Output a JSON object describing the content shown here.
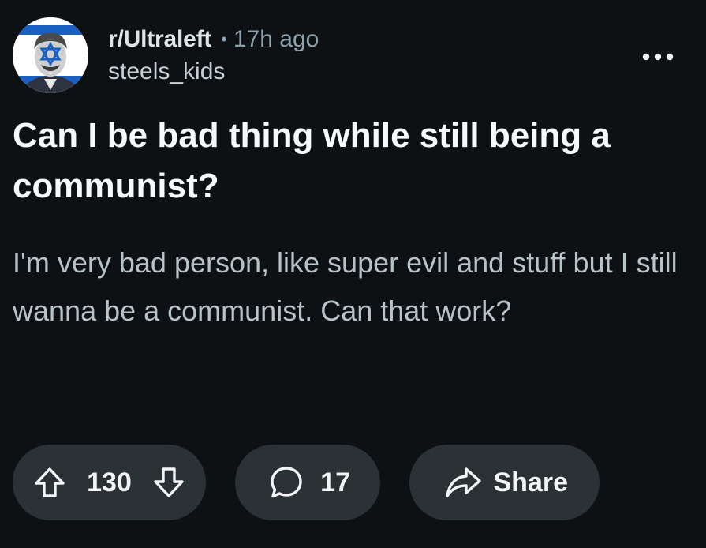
{
  "post": {
    "subreddit": "r/Ultraleft",
    "separator": "•",
    "time": "17h ago",
    "author": "steels_kids",
    "title": "Can I be bad thing while still being a communist?",
    "body": "I'm very bad person, like super evil and stuff but I still wanna be a communist. Can that work?"
  },
  "actions": {
    "upvotes": "130",
    "comments": "17",
    "share_label": "Share"
  },
  "icons": {
    "more": "more-options-icon",
    "upvote": "upvote-arrow-icon",
    "downvote": "downvote-arrow-icon",
    "comment": "comment-bubble-icon",
    "share": "share-arrow-icon"
  },
  "colors": {
    "background": "#0e1113",
    "pill": "#2a3236",
    "text_primary": "#f2f4f5",
    "text_secondary": "#8ba2ad",
    "body_text": "#b7c3c8"
  }
}
